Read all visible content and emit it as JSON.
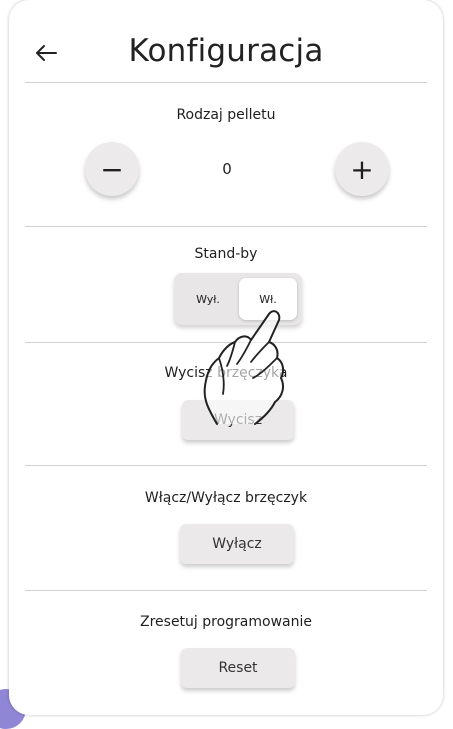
{
  "header": {
    "title": "Konfiguracja",
    "back_icon": "arrow-left-icon"
  },
  "pellet_type": {
    "label": "Rodzaj pelletu",
    "value": "0",
    "decrement_label": "−",
    "increment_label": "+"
  },
  "standby": {
    "label": "Stand-by",
    "options": [
      "Wył.",
      "Wł."
    ],
    "selected": "Wł."
  },
  "mute_buzzer": {
    "label": "Wycisz brzęczyka",
    "button_label": "Wycisz"
  },
  "toggle_buzzer": {
    "label": "Włącz/Wyłącz brzęczyk",
    "button_label": "Wyłącz"
  },
  "reset_programming": {
    "label": "Zresetuj programowanie",
    "button_label": "Reset"
  },
  "colors": {
    "accent": "#8f86d6",
    "button_bg": "#ebe9e9",
    "divider": "#cfcfcf"
  },
  "overlay_icon": "hand-pointer-icon"
}
